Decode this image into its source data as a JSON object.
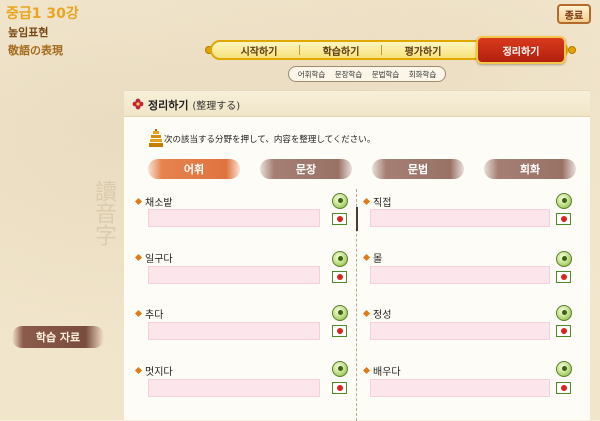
{
  "header": {
    "lesson_title": "중급1 30강",
    "lesson_ko": "높임표현",
    "lesson_jp": "敬語の表現",
    "end_label": "종료"
  },
  "main_tabs": [
    {
      "label": "시작하기"
    },
    {
      "label": "학습하기"
    },
    {
      "label": "평가하기"
    },
    {
      "label": "정리하기",
      "active": true
    }
  ],
  "sub_tabs": [
    {
      "label": "어휘학습"
    },
    {
      "label": "문장학습"
    },
    {
      "label": "문법학습"
    },
    {
      "label": "회화학습"
    }
  ],
  "sidebar": {
    "study_material": "학습 자료"
  },
  "panel": {
    "title": "정리하기",
    "title_sub": "(整理する)",
    "instruction": "次の該当する分野を押して、内容を整理してください。"
  },
  "categories": [
    {
      "label": "어휘",
      "active": true
    },
    {
      "label": "문장",
      "active": false
    },
    {
      "label": "문법",
      "active": false
    },
    {
      "label": "회화",
      "active": false
    }
  ],
  "vocab_left": [
    {
      "word": "채소밭"
    },
    {
      "word": "일구다"
    },
    {
      "word": "추다"
    },
    {
      "word": "멋지다"
    }
  ],
  "vocab_right": [
    {
      "word": "직접"
    },
    {
      "word": "몰"
    },
    {
      "word": "정성"
    },
    {
      "word": "배우다"
    }
  ],
  "colors": {
    "accent_orange": "#e9a51f",
    "active_tab_red": "#c02a14",
    "answer_pink": "#fce6ec"
  }
}
